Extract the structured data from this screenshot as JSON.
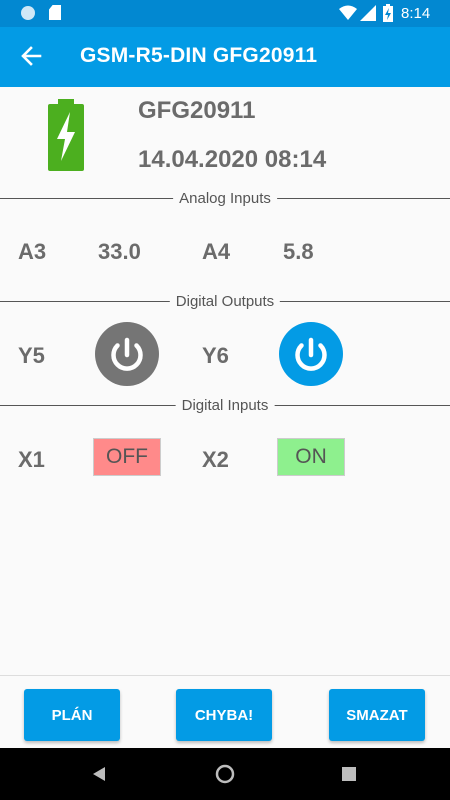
{
  "status_bar": {
    "time": "8:14"
  },
  "app_bar": {
    "title": "GSM-R5-DIN GFG20911"
  },
  "device": {
    "serial": "GFG20911",
    "datetime": "14.04.2020 08:14"
  },
  "analog_inputs": {
    "section_label": "Analog Inputs",
    "items": [
      {
        "name": "A3",
        "value": "33.0"
      },
      {
        "name": "A4",
        "value": "5.8"
      }
    ]
  },
  "digital_outputs": {
    "section_label": "Digital Outputs",
    "items": [
      {
        "name": "Y5",
        "state": "off",
        "color": "#757575"
      },
      {
        "name": "Y6",
        "state": "on",
        "color": "#039be5"
      }
    ]
  },
  "digital_inputs": {
    "section_label": "Digital Inputs",
    "items": [
      {
        "name": "X1",
        "state": "OFF",
        "color": "#ff8a8a"
      },
      {
        "name": "X2",
        "state": "ON",
        "color": "#8ef08e"
      }
    ]
  },
  "actions": {
    "plan": "PLÁN",
    "error": "CHYBA!",
    "delete": "SMAZAT"
  },
  "colors": {
    "accent": "#039be5",
    "status_bar": "#0288d1",
    "battery": "#4caf1f"
  }
}
